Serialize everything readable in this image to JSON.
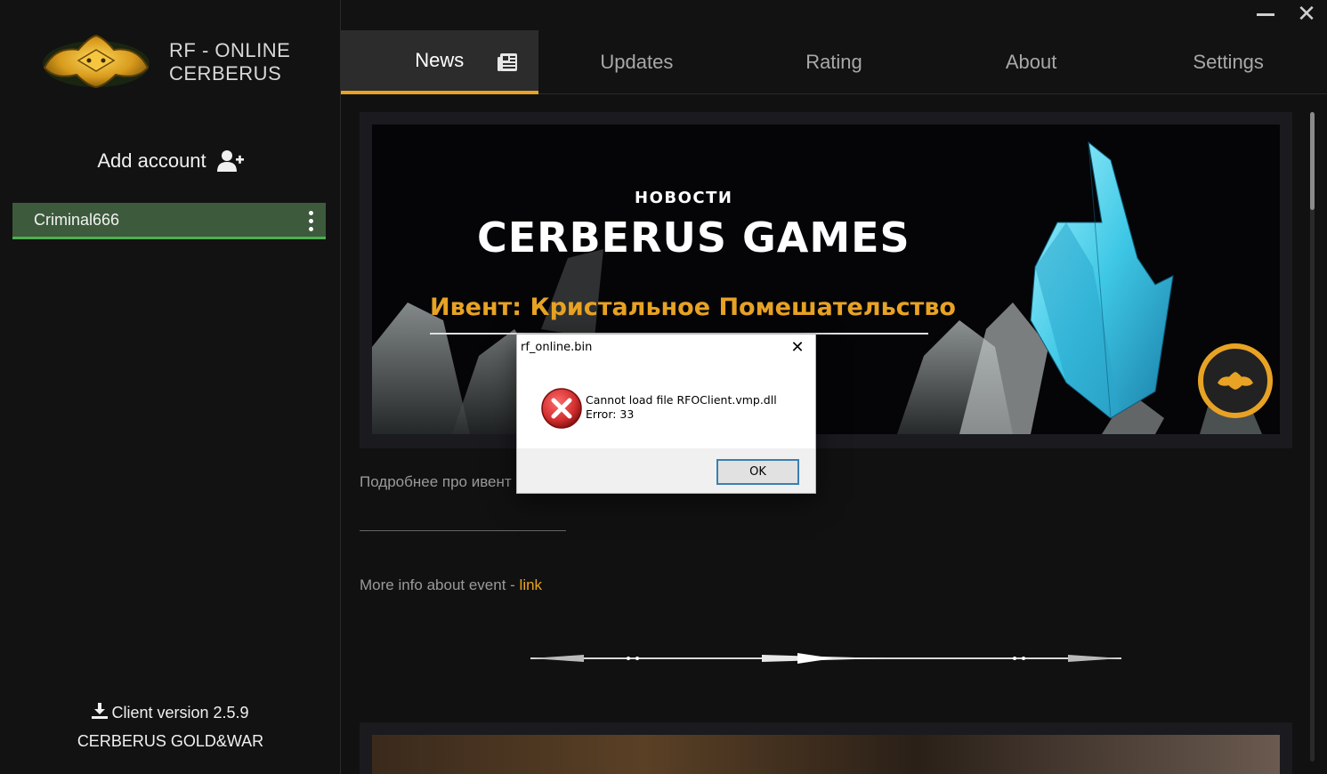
{
  "window": {
    "minimize_icon": "minimize-icon",
    "close_icon": "close-icon",
    "close_glyph": "✕"
  },
  "sidebar": {
    "brand_line1": "RF - ONLINE",
    "brand_line2": "CERBERUS",
    "add_account_label": "Add account",
    "accounts": [
      {
        "name": "Criminal666"
      }
    ],
    "client_version": "Client version 2.5.9",
    "client_brand": "CERBERUS GOLD&WAR"
  },
  "tabs": [
    {
      "label": "News",
      "active": true
    },
    {
      "label": "Updates",
      "active": false
    },
    {
      "label": "Rating",
      "active": false
    },
    {
      "label": "About",
      "active": false
    },
    {
      "label": "Settings",
      "active": false
    }
  ],
  "news": {
    "banner_small": "НОВОСТИ",
    "banner_title": "CERBERUS GAMES",
    "banner_event": "Ивент: Кристальное Помешательство",
    "more_ru": "Подробнее про ивент",
    "more_en_prefix": "More info about event - ",
    "more_en_link": "link"
  },
  "dialog": {
    "title": "rf_online.bin",
    "close_glyph": "✕",
    "message_line1": "Cannot load file RFOClient.vmp.dll",
    "message_line2": "Error: 33",
    "ok_label": "OK"
  },
  "colors": {
    "accent": "#e8a324",
    "account_bg": "#3d5a3d",
    "account_border": "#4caf50",
    "error_red": "#d32f2f"
  }
}
